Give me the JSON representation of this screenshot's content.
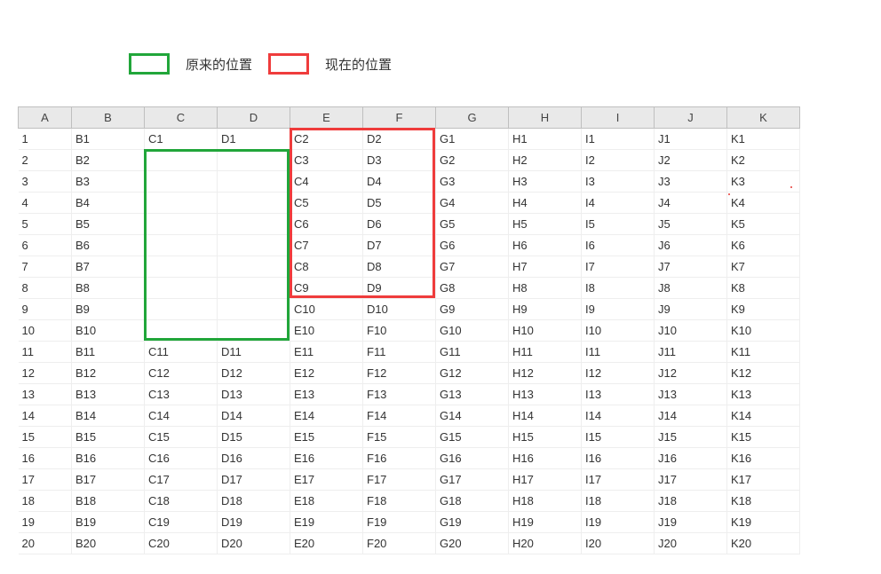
{
  "legend": {
    "original_label": "原来的位置",
    "current_label": "现在的位置"
  },
  "columns": [
    "A",
    "B",
    "C",
    "D",
    "E",
    "F",
    "G",
    "H",
    "I",
    "J",
    "K"
  ],
  "rows": [
    [
      "1",
      "B1",
      "C1",
      "D1",
      "C2",
      "D2",
      "G1",
      "H1",
      "I1",
      "J1",
      "K1"
    ],
    [
      "2",
      "B2",
      "",
      "",
      "C3",
      "D3",
      "G2",
      "H2",
      "I2",
      "J2",
      "K2"
    ],
    [
      "3",
      "B3",
      "",
      "",
      "C4",
      "D4",
      "G3",
      "H3",
      "I3",
      "J3",
      "K3"
    ],
    [
      "4",
      "B4",
      "",
      "",
      "C5",
      "D5",
      "G4",
      "H4",
      "I4",
      "J4",
      "K4"
    ],
    [
      "5",
      "B5",
      "",
      "",
      "C6",
      "D6",
      "G5",
      "H5",
      "I5",
      "J5",
      "K5"
    ],
    [
      "6",
      "B6",
      "",
      "",
      "C7",
      "D7",
      "G6",
      "H6",
      "I6",
      "J6",
      "K6"
    ],
    [
      "7",
      "B7",
      "",
      "",
      "C8",
      "D8",
      "G7",
      "H7",
      "I7",
      "J7",
      "K7"
    ],
    [
      "8",
      "B8",
      "",
      "",
      "C9",
      "D9",
      "G8",
      "H8",
      "I8",
      "J8",
      "K8"
    ],
    [
      "9",
      "B9",
      "",
      "",
      "C10",
      "D10",
      "G9",
      "H9",
      "I9",
      "J9",
      "K9"
    ],
    [
      "10",
      "B10",
      "",
      "",
      "E10",
      "F10",
      "G10",
      "H10",
      "I10",
      "J10",
      "K10"
    ],
    [
      "11",
      "B11",
      "C11",
      "D11",
      "E11",
      "F11",
      "G11",
      "H11",
      "I11",
      "J11",
      "K11"
    ],
    [
      "12",
      "B12",
      "C12",
      "D12",
      "E12",
      "F12",
      "G12",
      "H12",
      "I12",
      "J12",
      "K12"
    ],
    [
      "13",
      "B13",
      "C13",
      "D13",
      "E13",
      "F13",
      "G13",
      "H13",
      "I13",
      "J13",
      "K13"
    ],
    [
      "14",
      "B14",
      "C14",
      "D14",
      "E14",
      "F14",
      "G14",
      "H14",
      "I14",
      "J14",
      "K14"
    ],
    [
      "15",
      "B15",
      "C15",
      "D15",
      "E15",
      "F15",
      "G15",
      "H15",
      "I15",
      "J15",
      "K15"
    ],
    [
      "16",
      "B16",
      "C16",
      "D16",
      "E16",
      "F16",
      "G16",
      "H16",
      "I16",
      "J16",
      "K16"
    ],
    [
      "17",
      "B17",
      "C17",
      "D17",
      "E17",
      "F17",
      "G17",
      "H17",
      "I17",
      "J17",
      "K17"
    ],
    [
      "18",
      "B18",
      "C18",
      "D18",
      "E18",
      "F18",
      "G18",
      "H18",
      "I18",
      "J18",
      "K18"
    ],
    [
      "19",
      "B19",
      "C19",
      "D19",
      "E19",
      "F19",
      "G19",
      "H19",
      "I19",
      "J19",
      "K19"
    ],
    [
      "20",
      "B20",
      "C20",
      "D20",
      "E20",
      "F20",
      "G20",
      "H20",
      "I20",
      "J20",
      "K20"
    ]
  ],
  "green_box": {
    "col_start": 2,
    "col_span": 2,
    "row_start": 1,
    "row_span": 9
  },
  "red_box": {
    "col_start": 4,
    "col_span": 2,
    "row_start": 0,
    "row_span": 8
  },
  "chart_data": {
    "type": "table",
    "title": "",
    "description": "Spreadsheet with columns A–K showing that the block originally at C2:D10 (green outline, now blank except for residual labels) has been moved to E1:F8 (red outline, containing values C2..C9 and D2..D9).",
    "columns": [
      "A",
      "B",
      "C",
      "D",
      "E",
      "F",
      "G",
      "H",
      "I",
      "J",
      "K"
    ],
    "rows_displayed": 20,
    "original_block": {
      "range": "C2:D10",
      "outline_color": "green"
    },
    "moved_block": {
      "range": "E1:F8",
      "outline_color": "red",
      "values_col_E": [
        "C2",
        "C3",
        "C4",
        "C5",
        "C6",
        "C7",
        "C8",
        "C9"
      ],
      "values_col_F": [
        "D2",
        "D3",
        "D4",
        "D5",
        "D6",
        "D7",
        "D8",
        "D9"
      ]
    }
  }
}
